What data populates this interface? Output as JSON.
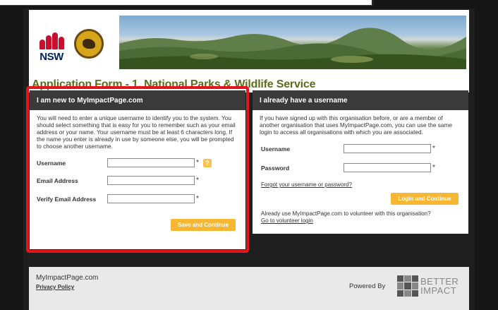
{
  "header": {
    "nsw_logo_text": "NSW",
    "nsw_logo_icon": "waratah-icon",
    "npws_logo_icon": "lyrebird-emblem-icon"
  },
  "page_title": "Application Form - 1. National Parks & Wildlife Service",
  "new_user": {
    "heading": "I am new to MyImpactPage.com",
    "intro": "You will need to enter a unique username to identify you to the system. You should select something that is easy for you to remember such as your email address or your name. Your username must be at least 6 characters long. If the name you enter is already in use by someone else, you will be prompted to choose another username.",
    "username_label": "Username",
    "email_label": "Email Address",
    "verify_email_label": "Verify Email Address",
    "required_mark": "*",
    "help_icon": "?",
    "save_button": "Save and Continue"
  },
  "existing_user": {
    "heading": "I already have a username",
    "intro": "If you have signed up with this organisation before, or are a member of another organisation that uses MyImpactPage.com, you can use the same login to access all organisations with which you are associated.",
    "username_label": "Username",
    "password_label": "Password",
    "required_mark": "*",
    "forgot_link": "Forgot your username or password?",
    "login_button": "Login and Continue",
    "volunteer_note": "Already use MyImpactPage.com to volunteer with this organisation?",
    "volunteer_link": "Go to volunteer login"
  },
  "footer": {
    "brand": "MyImpactPage.com",
    "privacy": "Privacy Policy",
    "powered_by": "Powered By",
    "better_impact_line1": "BETTER",
    "better_impact_line2": "IMPACT"
  }
}
